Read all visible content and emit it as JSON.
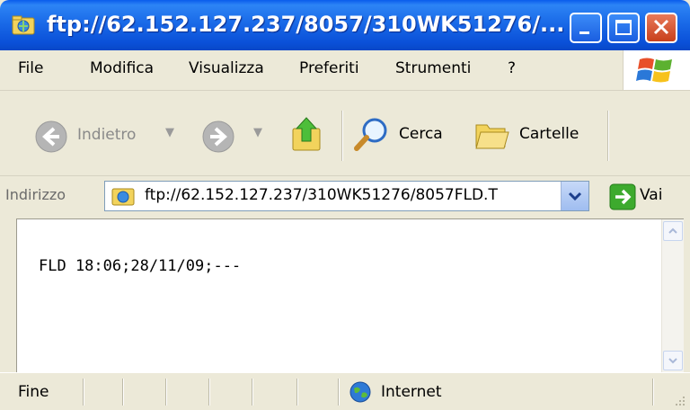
{
  "window": {
    "title": "ftp://62.152.127.237/8057/310WK51276/...",
    "controls": {
      "minimize": "minimize",
      "maximize": "maximize",
      "close": "close"
    }
  },
  "menu": {
    "items": [
      "File",
      "Modifica",
      "Visualizza",
      "Preferiti",
      "Strumenti",
      "?"
    ]
  },
  "toolbar": {
    "back_label": "Indietro",
    "search_label": "Cerca",
    "folders_label": "Cartelle"
  },
  "address": {
    "label": "Indirizzo",
    "value": "ftp://62.152.127.237/310WK51276/8057FLD.T",
    "go_label": "Vai"
  },
  "content": {
    "text": "FLD 18:06;28/11/09;---"
  },
  "status": {
    "text": "Fine",
    "zone": "Internet"
  },
  "icons": {
    "title_icon": "ftp-folder-icon",
    "back": "back-arrow-icon",
    "forward": "forward-arrow-icon",
    "up": "up-folder-icon",
    "search": "magnifier-icon",
    "folders": "folders-icon",
    "go": "go-arrow-icon",
    "zone": "globe-icon"
  }
}
